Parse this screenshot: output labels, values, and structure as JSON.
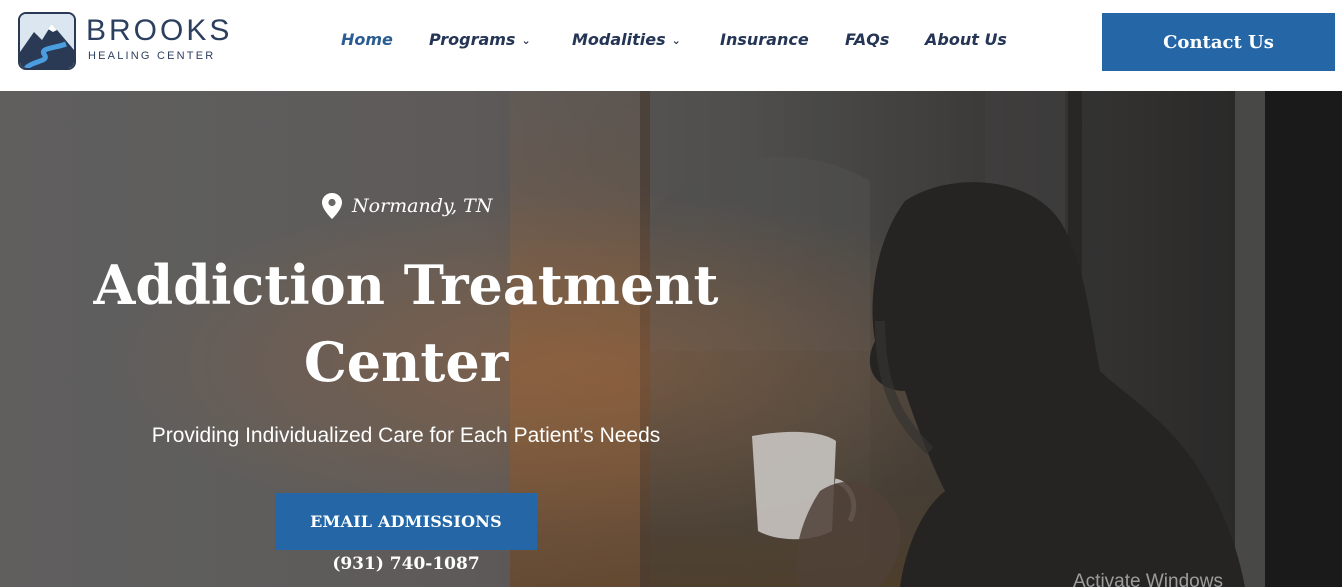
{
  "header": {
    "logo": {
      "name": "BROOKS",
      "subtitle": "HEALING CENTER"
    },
    "nav": [
      {
        "label": "Home",
        "active": true,
        "dropdown": false
      },
      {
        "label": "Programs",
        "active": false,
        "dropdown": true
      },
      {
        "label": "Modalities",
        "active": false,
        "dropdown": true
      },
      {
        "label": "Insurance",
        "active": false,
        "dropdown": false
      },
      {
        "label": "FAQs",
        "active": false,
        "dropdown": false
      },
      {
        "label": "About Us",
        "active": false,
        "dropdown": false
      }
    ],
    "contact_label": "Contact Us"
  },
  "hero": {
    "location": "Normandy, TN",
    "title_line1": "Addiction Treatment",
    "title_line2": "Center",
    "subtitle": "Providing Individualized Care for Each Patient’s Needs",
    "cta_label": "EMAIL ADMISSIONS",
    "phone": "(931) 740-1087"
  },
  "overlay": {
    "watermark": "Activate Windows"
  },
  "icons": {
    "location": "map-pin-icon",
    "dropdown": "chevron-down-icon",
    "logo": "mountain-river-logo-icon"
  },
  "colors": {
    "brand_navy": "#2c3f5e",
    "nav_text": "#253555",
    "nav_active": "#2b5d93",
    "button_blue": "#2466a6",
    "white": "#ffffff"
  }
}
